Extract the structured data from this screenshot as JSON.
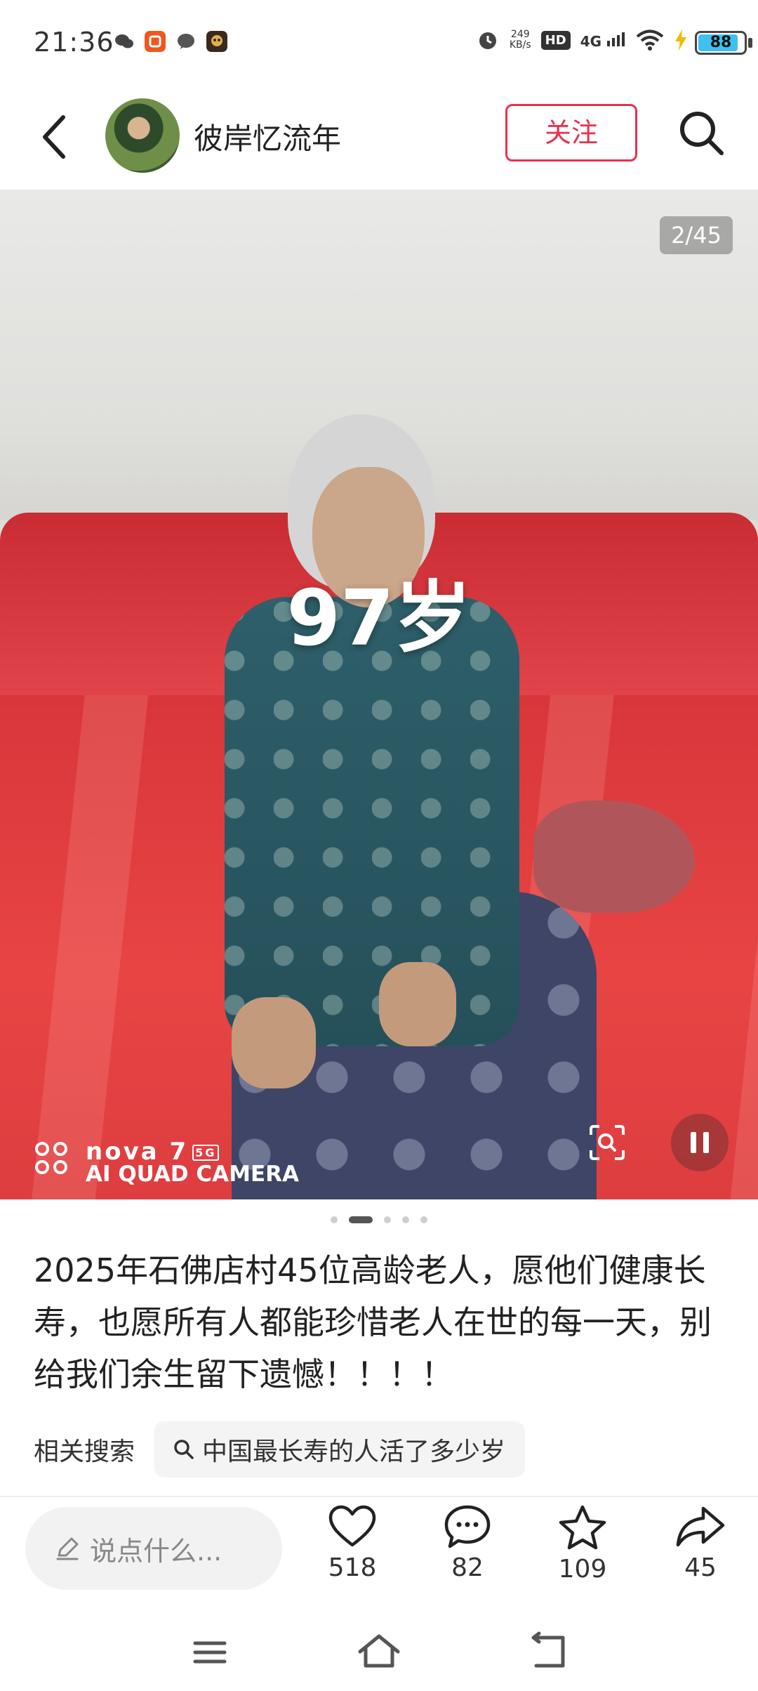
{
  "status_bar": {
    "time": "21:36",
    "net_speed_value": "249",
    "net_speed_unit": "KB/s",
    "hd": "HD",
    "network": "4G",
    "battery": "88",
    "battery_level_percent": 88,
    "app_icons": [
      "wechat-icon",
      "taobao-icon",
      "message-icon",
      "game-icon"
    ]
  },
  "header": {
    "author_name": "彼岸忆流年",
    "follow_label": "关注"
  },
  "post_image": {
    "page_counter": "2/45",
    "overlay_text": "97岁",
    "camera_line1": "nova 7",
    "camera_badge": "5G",
    "camera_line2": "AI QUAD CAMERA"
  },
  "carousel": {
    "count": 5,
    "active_index": 1
  },
  "post": {
    "caption": "2025年石佛店村45位高龄老人，愿他们健康长寿，也愿所有人都能珍惜老人在世的每一天，别给我们余生留下遗憾！！！！"
  },
  "related_search": {
    "label": "相关搜索",
    "query": "中国最长寿的人活了多少岁"
  },
  "bottom_bar": {
    "comment_placeholder": "说点什么...",
    "likes": "518",
    "comments": "82",
    "favorites": "109",
    "shares": "45"
  },
  "colors": {
    "accent": "#e8314f",
    "sofa_red": "#e03c42"
  }
}
